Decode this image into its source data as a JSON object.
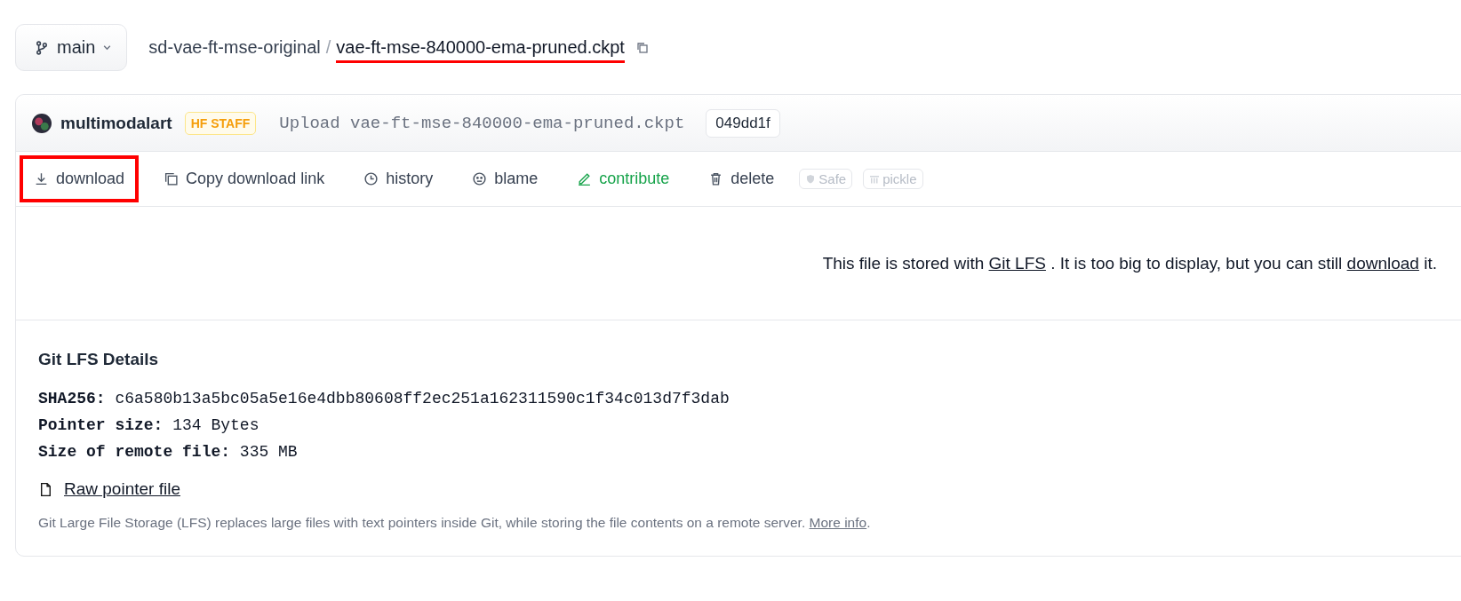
{
  "branch": {
    "label": "main"
  },
  "breadcrumb": {
    "repo": "sd-vae-ft-mse-original",
    "separator": "/",
    "file": "vae-ft-mse-840000-ema-pruned.ckpt",
    "file_highlighted": true
  },
  "commit": {
    "author": "multimodalart",
    "badge": "HF STAFF",
    "message": "Upload vae-ft-mse-840000-ema-pruned.ckpt",
    "hash": "049dd1f"
  },
  "actions": [
    {
      "kind": "download",
      "label": "download",
      "highlighted": true
    },
    {
      "kind": "copy",
      "label": "Copy download link",
      "highlighted": false
    },
    {
      "kind": "history",
      "label": "history",
      "highlighted": false
    },
    {
      "kind": "blame",
      "label": "blame",
      "highlighted": false
    },
    {
      "kind": "contribute",
      "label": "contribute",
      "highlighted": false,
      "color": "#16a34a"
    },
    {
      "kind": "delete",
      "label": "delete",
      "highlighted": false
    },
    {
      "kind": "safe",
      "label": "Safe",
      "highlighted": false
    },
    {
      "kind": "pickle",
      "label": "pickle",
      "highlighted": false
    }
  ],
  "notice": {
    "before": "This file is stored with",
    "link1": "Git LFS",
    "middle": ". It is too big to display, but you can still",
    "link2": "download",
    "after": "it."
  },
  "details": {
    "title": "Git LFS Details",
    "rows": [
      {
        "label": "SHA256:",
        "value": "c6a580b13a5bc05a5e16e4dbb80608ff2ec251a162311590c1f34c013d7f3dab"
      },
      {
        "label": "Pointer size:",
        "value": "134 Bytes"
      },
      {
        "label": "Size of remote file:",
        "value": "335 MB"
      }
    ],
    "raw_link": "Raw pointer file",
    "footnote": "Git Large File Storage (LFS) replaces large files with text pointers inside Git, while storing the file contents on a remote server.",
    "footnote_link": "More info",
    "footnote_end": "."
  }
}
